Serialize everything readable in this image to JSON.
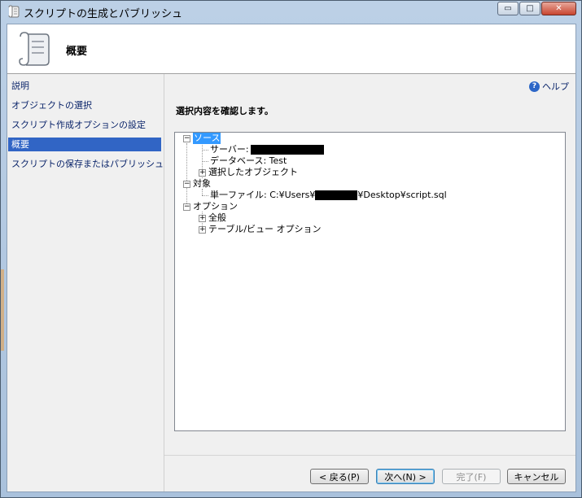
{
  "window": {
    "title": "スクリプトの生成とパブリッシュ",
    "minimize": "▭",
    "maximize": "□",
    "close": "✕"
  },
  "header": {
    "title": "概要"
  },
  "sidebar": {
    "items": [
      {
        "label": "説明"
      },
      {
        "label": "オブジェクトの選択"
      },
      {
        "label": "スクリプト作成オプションの設定"
      },
      {
        "label": "概要"
      },
      {
        "label": "スクリプトの保存またはパブリッシュ"
      }
    ],
    "selected_index": 3
  },
  "main": {
    "help_label": "ヘルプ",
    "help_icon": "?",
    "instruction": "選択内容を確認します。"
  },
  "tree": {
    "source": "ソース",
    "server_label": "サーバー:",
    "database_label": "データベース: Test",
    "selected_objects": "選択したオブジェクト",
    "target": "対象",
    "file_prefix": "単一ファイル: C:¥Users¥",
    "file_suffix": "¥Desktop¥script.sql",
    "options": "オプション",
    "general": "全般",
    "table_view": "テーブル/ビュー オプション",
    "collapse_glyph": "−",
    "expand_glyph": "+"
  },
  "buttons": {
    "back": "< 戻る(P)",
    "next": "次へ(N) >",
    "finish": "完了(F)",
    "cancel": "キャンセル"
  }
}
